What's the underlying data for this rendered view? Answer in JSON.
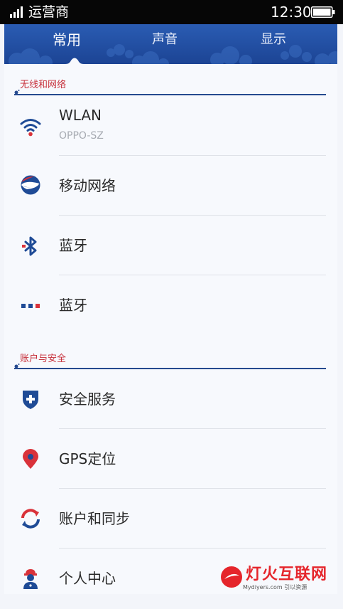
{
  "status_bar": {
    "carrier": "运营商",
    "time": "12:30"
  },
  "tabs": [
    {
      "label": "常用",
      "active": true
    },
    {
      "label": "声音",
      "active": false
    },
    {
      "label": "显示",
      "active": false
    }
  ],
  "sections": [
    {
      "title": "无线和网络",
      "items": [
        {
          "label": "WLAN",
          "subtitle": "OPPO-SZ",
          "icon": "wifi-icon"
        },
        {
          "label": "移动网络",
          "icon": "mobile-network-icon"
        },
        {
          "label": "蓝牙",
          "icon": "bluetooth-icon"
        },
        {
          "label": "蓝牙",
          "icon": "more-dots-icon"
        }
      ]
    },
    {
      "title": "账户与安全",
      "items": [
        {
          "label": "安全服务",
          "icon": "shield-icon"
        },
        {
          "label": "GPS定位",
          "icon": "location-pin-icon"
        },
        {
          "label": "账户和同步",
          "icon": "sync-icon"
        },
        {
          "label": "个人中心",
          "icon": "person-icon"
        }
      ]
    }
  ],
  "watermark": {
    "text": "灯火互联网",
    "url": "Mydiyers.com 引以资源"
  },
  "colors": {
    "header": "#2152a6",
    "accent_red": "#c7303b",
    "icon_blue": "#1f4b96",
    "section_line": "#254a8f"
  }
}
